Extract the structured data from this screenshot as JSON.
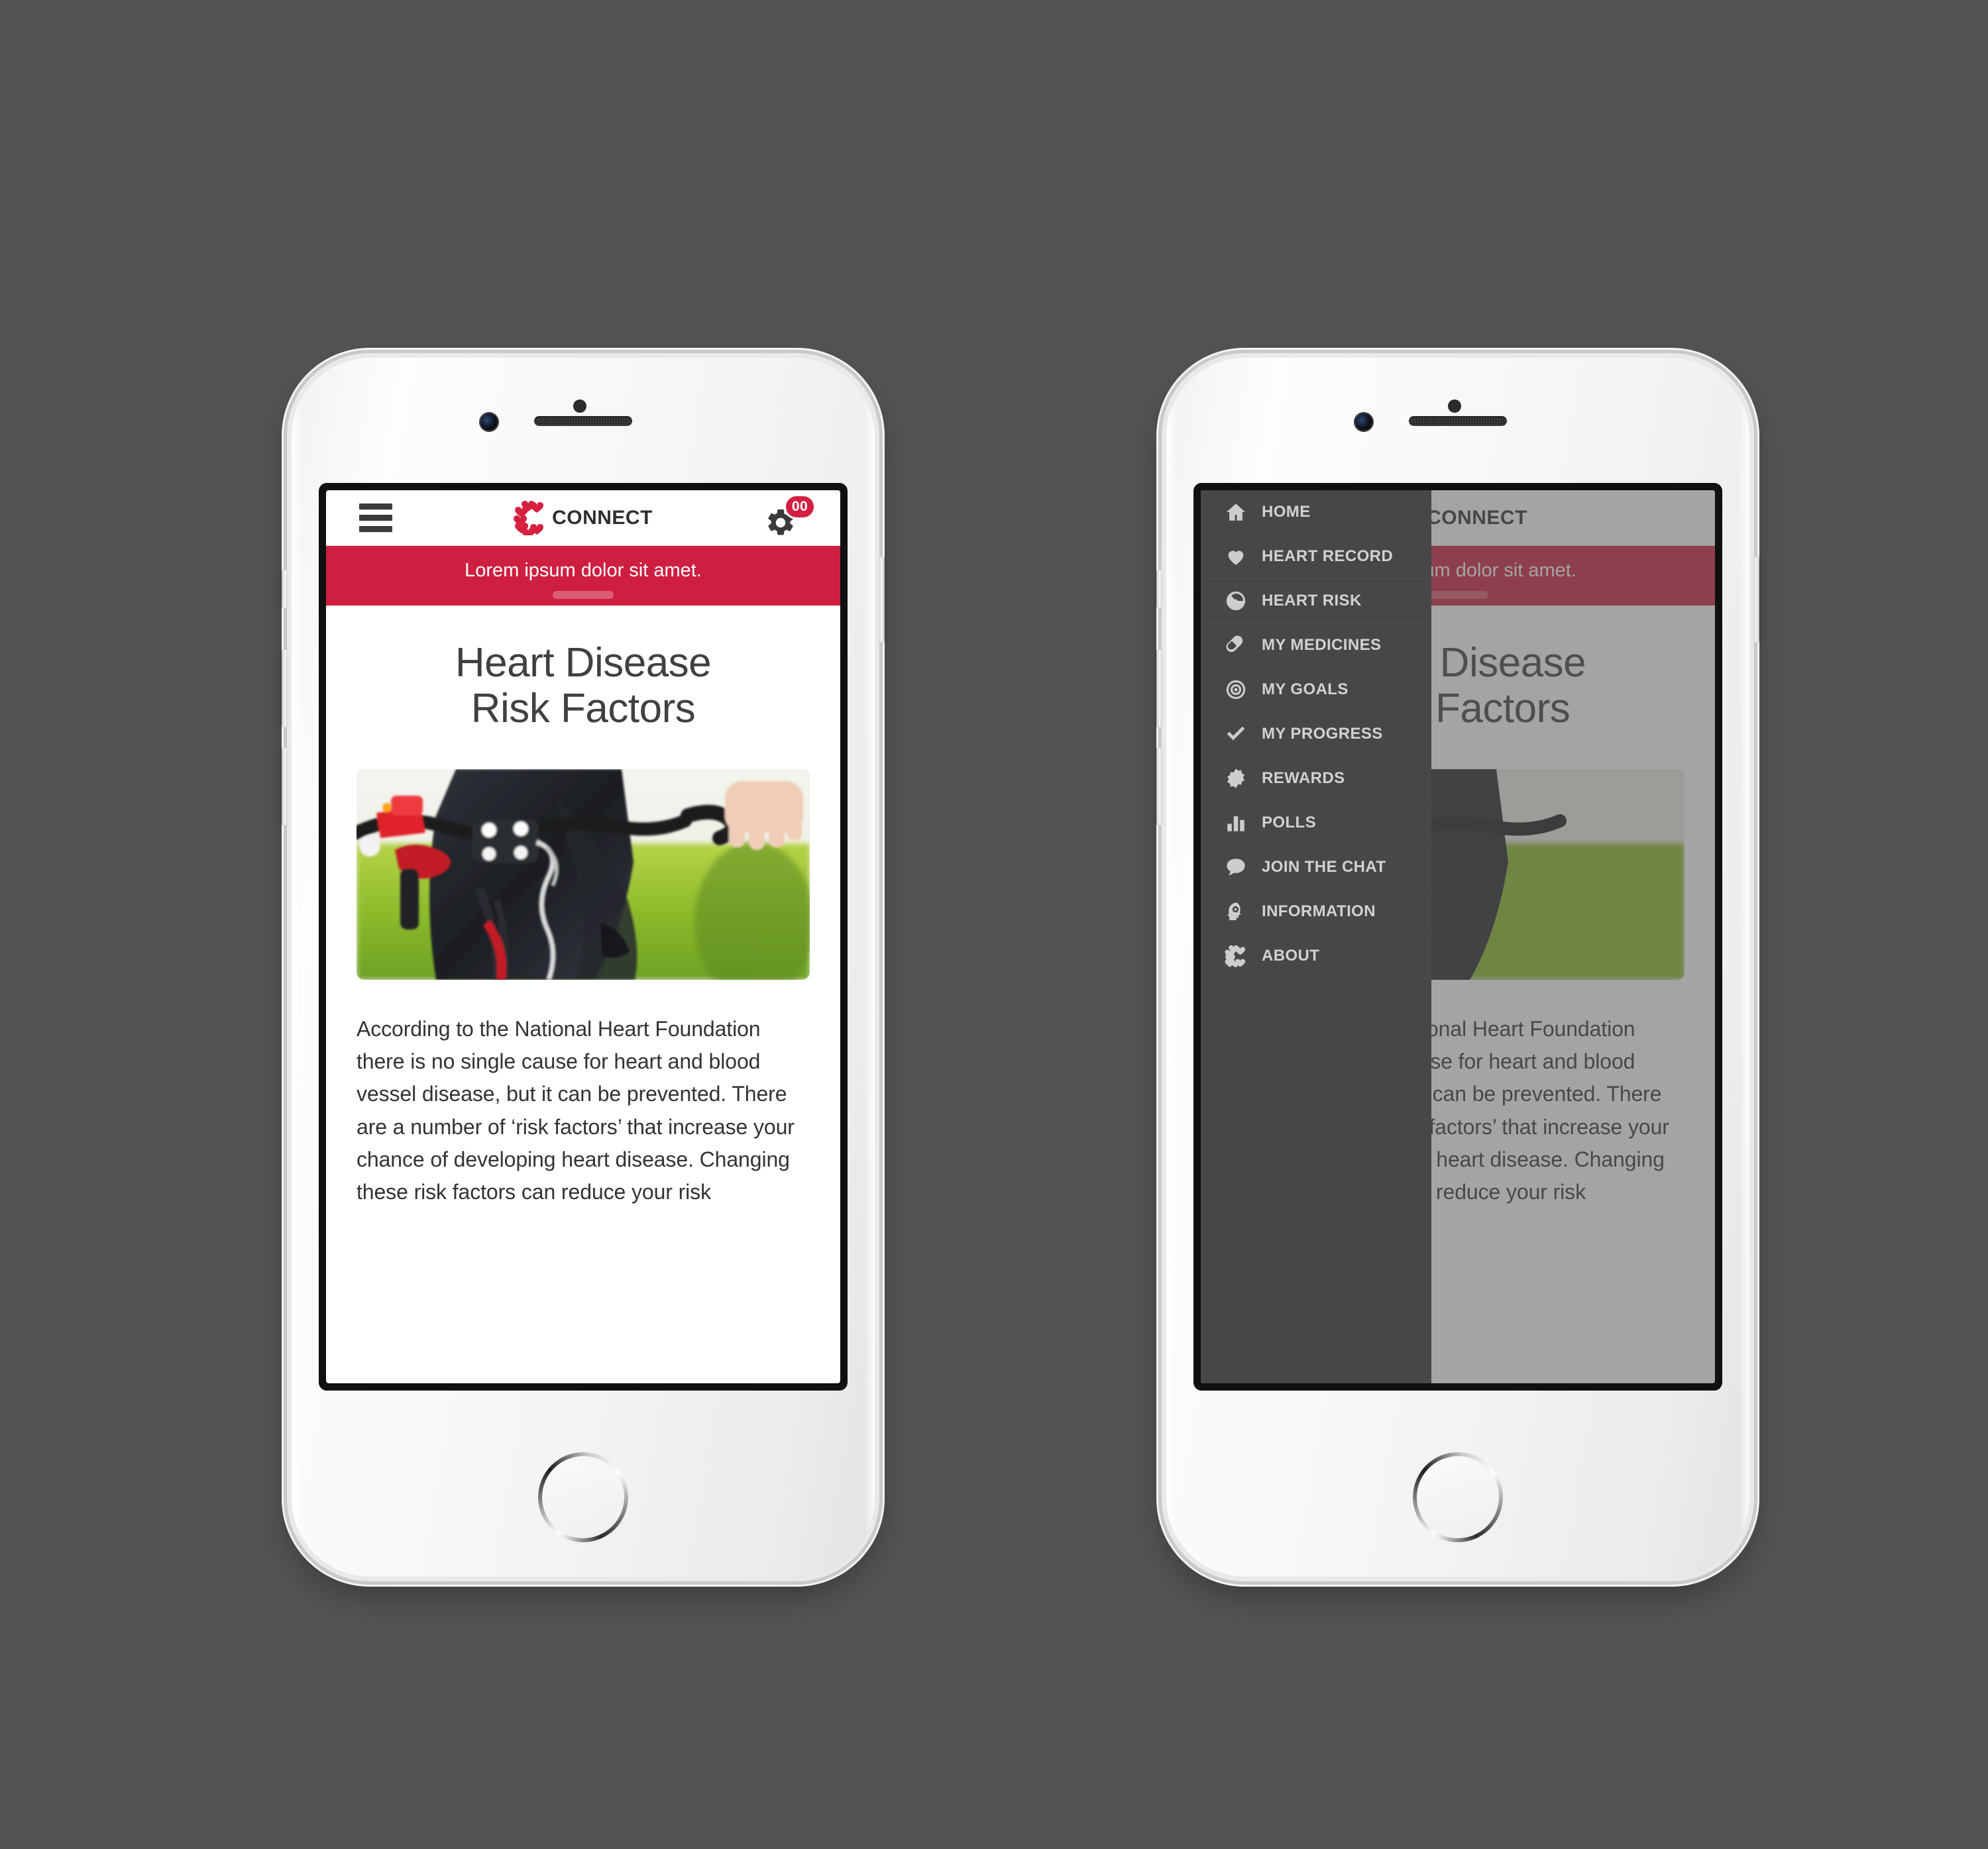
{
  "app": {
    "brand_name": "CONNECT",
    "brand_color": "#CE1F41",
    "gear_badge_count": "00",
    "banner_text": "Lorem ipsum dolor sit amet.",
    "banner_color": "#CE1F41"
  },
  "article": {
    "title_line1": "Heart Disease",
    "title_line2": "Risk Factors",
    "body": "According to the National Heart Foundation there is no single cause for heart and blood vessel disease, but it can be prevented. There are a number of ‘risk factors’ that increase your chance of developing heart disease. Changing these risk factors can reduce your risk",
    "hero_alt": "cyclist-handlebars-photo"
  },
  "drawer": {
    "background_color": "#474747",
    "items": [
      {
        "label": "HOME",
        "icon": "home-icon"
      },
      {
        "label": "HEART RECORD",
        "icon": "heart-icon"
      },
      {
        "label": "HEART RISK",
        "icon": "gauge-icon"
      },
      {
        "label": "MY MEDICINES",
        "icon": "pill-icon"
      },
      {
        "label": "MY GOALS",
        "icon": "target-icon"
      },
      {
        "label": "MY PROGRESS",
        "icon": "check-icon"
      },
      {
        "label": "REWARDS",
        "icon": "badge-icon"
      },
      {
        "label": "POLLS",
        "icon": "bar-chart-icon"
      },
      {
        "label": "JOIN THE CHAT",
        "icon": "speech-bubble-icon"
      },
      {
        "label": "INFORMATION",
        "icon": "head-gear-icon"
      },
      {
        "label": "ABOUT",
        "icon": "connect-c-icon"
      }
    ]
  },
  "phones": {
    "left_state": "content view",
    "right_state": "navigation drawer open"
  }
}
